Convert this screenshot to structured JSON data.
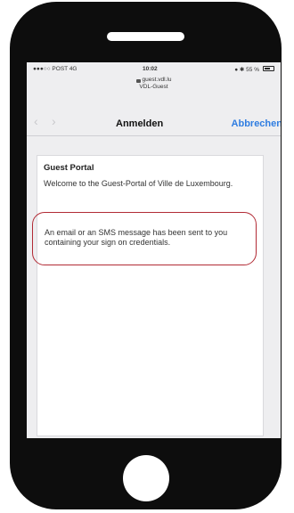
{
  "status_bar": {
    "carrier": "●●●○○ POST  4G",
    "time": "10:02",
    "battery": "● ✱ 55 %"
  },
  "browser": {
    "url": "guest.vdl.lu",
    "network": "VDL-Guest"
  },
  "nav": {
    "back_icon": "‹",
    "forward_icon": "›",
    "title": "Anmelden",
    "cancel_label": "Abbrechen"
  },
  "portal": {
    "title": "Guest Portal",
    "welcome": "Welcome to the Guest-Portal of Ville de Luxembourg.",
    "notice": "An email or an SMS message has been sent to you containing your sign on credentials."
  },
  "colors": {
    "accent": "#2f7de1",
    "highlight": "#b22b35",
    "device": "#0d0d0d"
  }
}
